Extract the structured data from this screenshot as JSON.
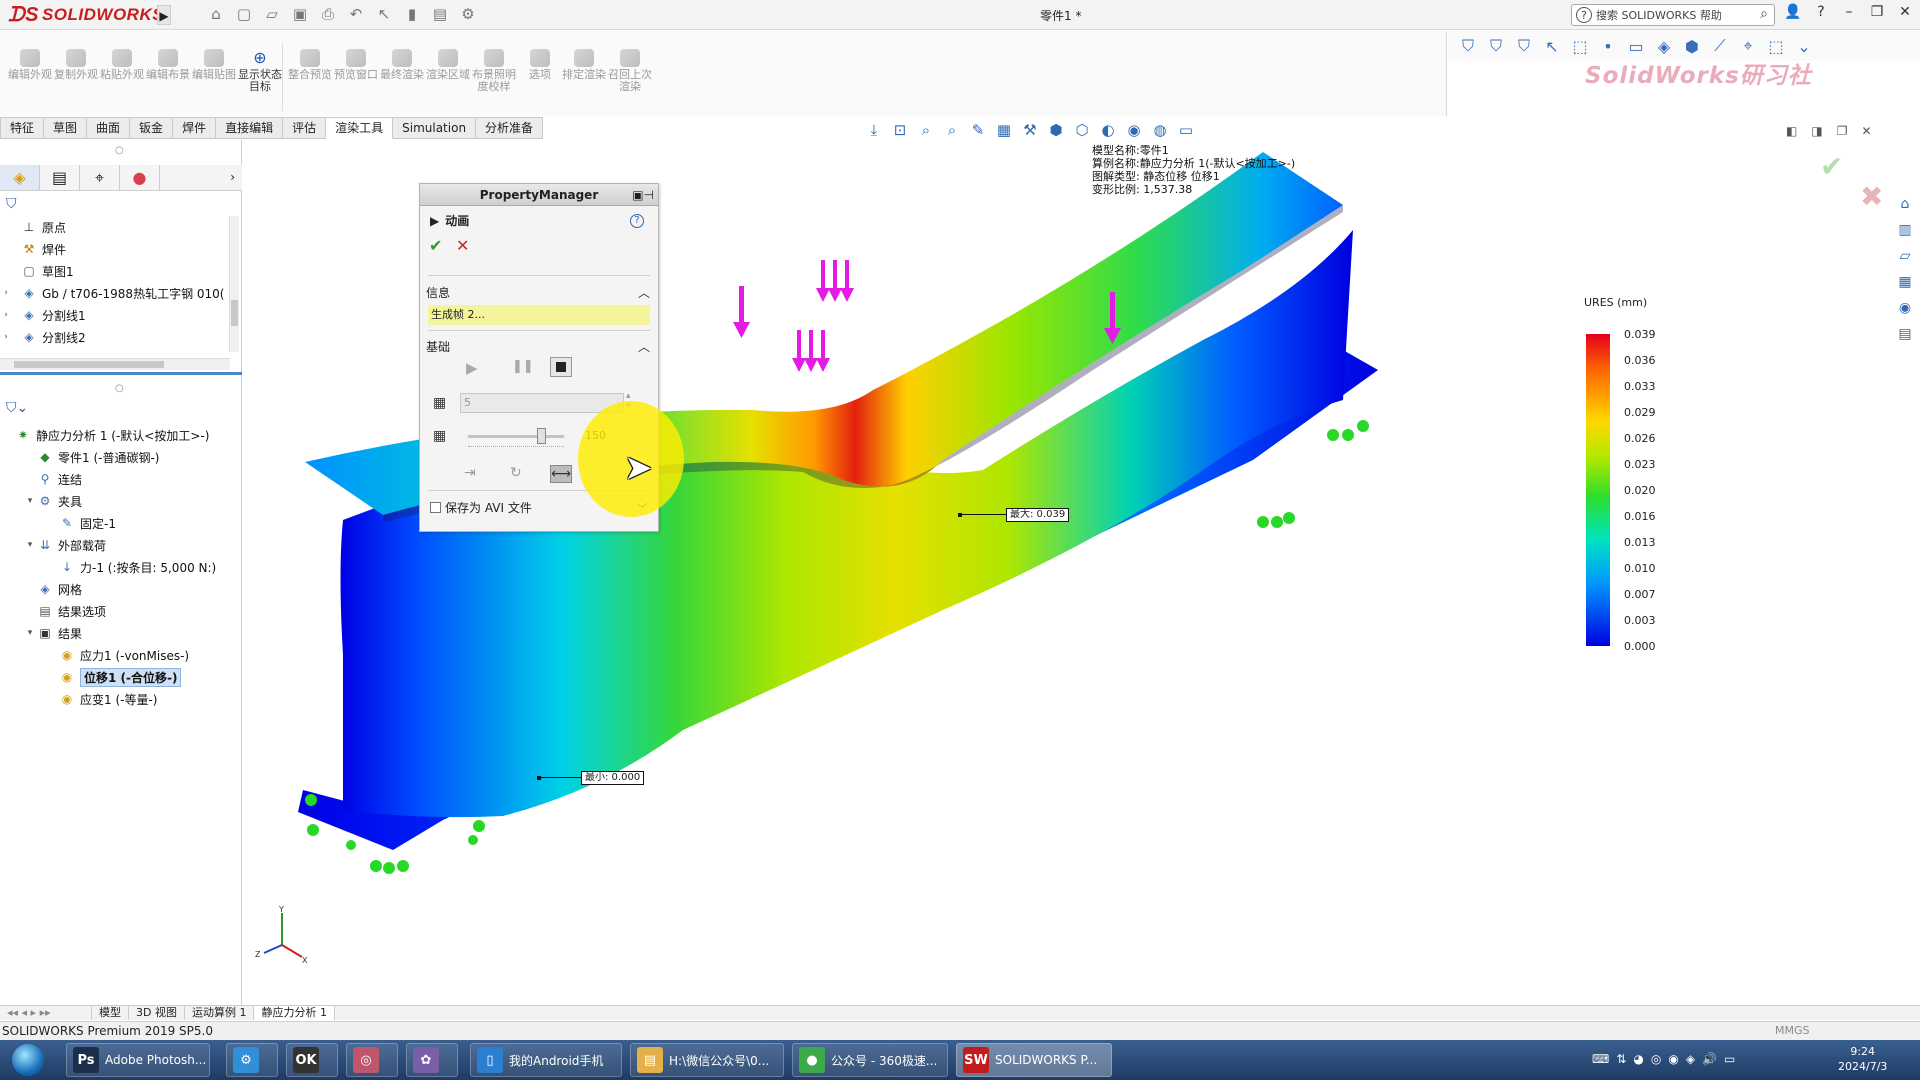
{
  "app": {
    "logo_text": "SOLIDWORKS",
    "doc_title": "零件1 *",
    "help_placeholder": "搜索 SOLIDWORKS 帮助",
    "watermark": "SolidWorks研习社"
  },
  "command_manager": {
    "buttons": [
      {
        "label": "编辑外观"
      },
      {
        "label": "复制外观"
      },
      {
        "label": "粘贴外观"
      },
      {
        "label": "编辑布景"
      },
      {
        "label": "编辑贴图"
      },
      {
        "label": "显示状态目标"
      },
      {
        "label": "整合预览"
      },
      {
        "label": "预览窗口"
      },
      {
        "label": "最终渲染"
      },
      {
        "label": "渲染区域"
      },
      {
        "label": "布景照明度校样"
      },
      {
        "label": "选项"
      },
      {
        "label": "排定渲染"
      },
      {
        "label": "召回上次渲染"
      }
    ]
  },
  "tabs": [
    "特征",
    "草图",
    "曲面",
    "钣金",
    "焊件",
    "直接编辑",
    "评估",
    "渲染工具",
    "Simulation",
    "分析准备"
  ],
  "active_tab": "渲染工具",
  "feature_tree": [
    {
      "label": "原点",
      "icon": "origin-icon",
      "expand": ""
    },
    {
      "label": "焊件",
      "icon": "weldment-icon",
      "expand": ""
    },
    {
      "label": "草图1",
      "icon": "sketch-icon",
      "expand": ""
    },
    {
      "label": "Gb / t706-1988热轧工字钢 010(",
      "icon": "structural-member-icon",
      "expand": "›"
    },
    {
      "label": "分割线1",
      "icon": "split-line-icon",
      "expand": "›"
    },
    {
      "label": "分割线2",
      "icon": "split-line-icon",
      "expand": "›"
    }
  ],
  "sim_tree": [
    {
      "label": "静应力分析 1 (-默认<按加工>-)",
      "indent": 0,
      "expand": "",
      "icon": "static-study-icon"
    },
    {
      "label": "零件1 (-普通碳钢-)",
      "indent": 1,
      "expand": "",
      "icon": "part-icon"
    },
    {
      "label": "连结",
      "indent": 1,
      "expand": "",
      "icon": "connections-icon"
    },
    {
      "label": "夹具",
      "indent": 1,
      "expand": "▾",
      "icon": "fixtures-icon"
    },
    {
      "label": "固定-1",
      "indent": 2,
      "expand": "",
      "icon": "fixed-icon"
    },
    {
      "label": "外部载荷",
      "indent": 1,
      "expand": "▾",
      "icon": "external-loads-icon"
    },
    {
      "label": "力-1 (:按条目: 5,000 N:)",
      "indent": 2,
      "expand": "",
      "icon": "force-icon"
    },
    {
      "label": "网格",
      "indent": 1,
      "expand": "",
      "icon": "mesh-icon"
    },
    {
      "label": "结果选项",
      "indent": 1,
      "expand": "",
      "icon": "result-options-icon"
    },
    {
      "label": "结果",
      "indent": 1,
      "expand": "▾",
      "icon": "results-folder-icon"
    },
    {
      "label": "应力1 (-vonMises-)",
      "indent": 2,
      "expand": "",
      "icon": "stress-plot-icon"
    },
    {
      "label": "位移1 (-合位移-)",
      "indent": 2,
      "expand": "",
      "icon": "displacement-plot-icon",
      "selected": true
    },
    {
      "label": "应变1 (-等量-)",
      "indent": 2,
      "expand": "",
      "icon": "strain-plot-icon"
    }
  ],
  "property_manager": {
    "header": "PropertyManager",
    "title": "动画",
    "info_section": "信息",
    "info_text": "生成帧 2...",
    "basic_section": "基础",
    "frames_value": "5",
    "speed_value": "150",
    "speed_fraction": 0.76,
    "save_avi_label": "保存为 AVI 文件"
  },
  "model_info": {
    "line1": "模型名称:零件1",
    "line2": "算例名称:静应力分析 1(-默认<按加工>-)",
    "line3": "图解类型: 静态位移 位移1",
    "line4": "变形比例: 1,537.38"
  },
  "legend": {
    "title": "URES (mm)",
    "ticks": [
      "0.039",
      "0.036",
      "0.033",
      "0.029",
      "0.026",
      "0.023",
      "0.020",
      "0.016",
      "0.013",
      "0.010",
      "0.007",
      "0.003",
      "0.000"
    ]
  },
  "probes": {
    "max_label": "最大: 0.039",
    "min_label": "最小: 0.000"
  },
  "bottom_tabs": [
    "模型",
    "3D 视图",
    "运动算例 1",
    "静应力分析 1"
  ],
  "active_bottom_tab": "静应力分析 1",
  "status": {
    "text": "SOLIDWORKS Premium 2019 SP5.0",
    "units": "MMGS"
  },
  "taskbar": {
    "items": [
      {
        "label": "Adobe Photosh...",
        "icon_text": "Ps",
        "color": "#1b2f4d"
      },
      {
        "label": "",
        "icon_text": "⚙",
        "color": "#2f8fd9"
      },
      {
        "label": "",
        "icon_text": "OK",
        "color": "#333333"
      },
      {
        "label": "",
        "icon_text": "◎",
        "color": "#c0566b"
      },
      {
        "label": "",
        "icon_text": "✿",
        "color": "#7a5ea8"
      },
      {
        "label": "我的Android手机",
        "icon_text": "▯",
        "color": "#2a7fd1"
      },
      {
        "label": "H:\\微信公众号\\0...",
        "icon_text": "▤",
        "color": "#e3b04b"
      },
      {
        "label": "公众号 - 360极速...",
        "icon_text": "●",
        "color": "#3bab4a"
      },
      {
        "label": "SOLIDWORKS P...",
        "icon_text": "SW",
        "color": "#c21c1c"
      }
    ],
    "time": "9:24",
    "date": "2024/7/3"
  }
}
